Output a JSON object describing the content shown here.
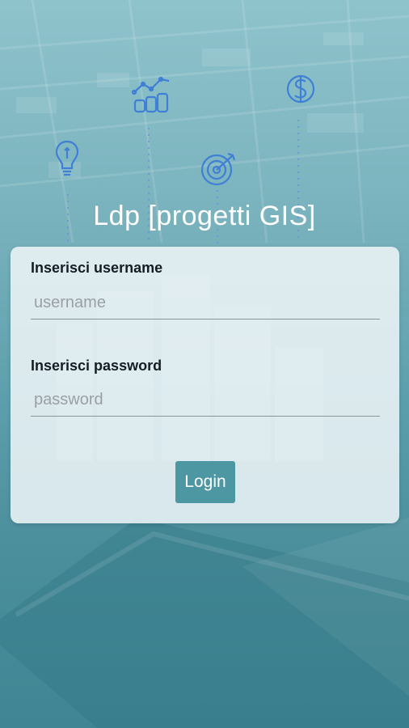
{
  "app": {
    "title": "Ldp [progetti GIS]"
  },
  "login_form": {
    "username_label": "Inserisci username",
    "username_placeholder": "username",
    "username_value": "",
    "password_label": "Inserisci password",
    "password_placeholder": "password",
    "password_value": "",
    "login_button_label": "Login"
  },
  "background": {
    "icons": [
      "lightbulb-icon",
      "growth-chart-coins-icon",
      "target-icon",
      "dollar-globe-icon"
    ]
  },
  "colors": {
    "accent": "#4d97a2",
    "background_top": "#8fc3cc",
    "background_bottom": "#3f8593",
    "icon_blue": "#3f7fd6"
  }
}
